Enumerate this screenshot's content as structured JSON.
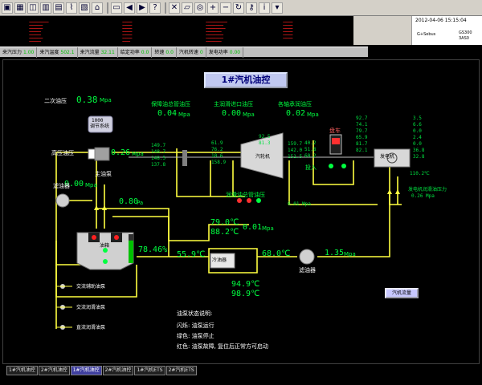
{
  "toolbar": {
    "icons": [
      "window-icon",
      "grid-icon",
      "chart-icon",
      "bar-icon",
      "table-icon",
      "trend-icon",
      "report-icon",
      "home-icon",
      "print-icon",
      "back-icon",
      "forward-icon",
      "help-icon",
      "close-icon",
      "folder-icon",
      "find-icon",
      "zoom-in-icon",
      "zoom-out-icon",
      "refresh-icon",
      "key-icon",
      "info-icon",
      "dropdown-icon"
    ]
  },
  "header": {
    "datetime": "2012-04-06  15:15:04",
    "station_left": "G+Sebus",
    "station_right_1": "GS300",
    "station_right_2": "3AS0"
  },
  "status_strip": [
    {
      "label": "来汽压力",
      "value": "1.00"
    },
    {
      "label": "来汽温度",
      "value": "502.1"
    },
    {
      "label": "来汽流量",
      "value": "32.11"
    },
    {
      "label": "给定功率",
      "value": "0.0"
    },
    {
      "label": "转速",
      "value": "0.0"
    },
    {
      "label": "汽机转速",
      "value": "0"
    },
    {
      "label": "发电功率",
      "value": "0.00"
    }
  ],
  "screen": {
    "title": "1#汽机油控",
    "secondary_oil_label": "二次油压",
    "secondary_oil_value": "0.38",
    "unit_mpa": "Mpa",
    "unit_pa": "Pa",
    "lube_header_label": "保障油总管油压",
    "lube_header_value": "0.04",
    "main_lube_label": "主润滑进口油压",
    "main_lube_value": "0.00",
    "bearing_oil_label": "各轴承润油压",
    "bearing_oil_value": "0.02",
    "hp_oil_label": "高压油压",
    "hp_oil_value": "0.26",
    "main_pump_label": "主油泵",
    "main_pump_value": "0.00",
    "filter_label": "滤油器",
    "filter_value": "0.80",
    "tank_label": "油箱",
    "tank_level_pct": 78.46,
    "tank_level_text": "78.46%",
    "cooler_label": "冷油器",
    "oil_temp_in_1": "79.0℃",
    "oil_temp_in_2": "88.2℃",
    "cooler_pressure": "0.01",
    "oil_temp_left": "55.9℃",
    "oil_temp_right": "68.0℃",
    "oil_temp_out_1": "94.9℃",
    "oil_temp_out_2": "98.9℃",
    "second_filter_label": "滤油器",
    "second_filter_pressure": "1.35",
    "turbine_label": "汽轮机",
    "generator_label": "发电机",
    "turning_gear_label": "盘车",
    "turning_gear_in": "投入",
    "speed_reg_label": "调节系统",
    "speed_reg_value": "1000",
    "bearing_temp_cols": [
      [
        "149.7",
        "148.7",
        "148.5",
        "137.8"
      ],
      [
        "61.9",
        "76.2",
        "10.6",
        "158.9"
      ],
      [
        "92.5",
        "81.3"
      ],
      [
        "40.2",
        "51.8",
        "60.2"
      ],
      [
        "159.7",
        "142.0",
        "151.5"
      ],
      [
        "92.7",
        "74.1",
        "79.7",
        "65.9",
        "81.7",
        "82.1"
      ],
      [
        "3.5",
        "6.6",
        "0.0",
        "2.4",
        "0.0",
        "36.8",
        "32.8"
      ]
    ],
    "bearing_temp_unit": "℃",
    "bearing_header_pressure_label": "润滑油总管油压",
    "lube_small_value": "0.01",
    "generator_oil_label": "发电机润滑油压力",
    "generator_oil_value": "0.26",
    "generator_temp": "110.2℃",
    "ac_pump_1": "交流辅助油泵",
    "ac_pump_2": "交流润滑油泵",
    "dc_pump": "直流润滑油泵",
    "legend_title": "油泵状态说明:",
    "legend_lines": [
      "闪烁: 油泵运行",
      "绿色: 油泵停止",
      "红色: 油泵故障, 复位后正常方可启动"
    ],
    "steam_flow_button": "汽机流量"
  },
  "tabs": [
    {
      "label": "1#汽机油控",
      "active": false
    },
    {
      "label": "2#汽机油控",
      "active": false
    },
    {
      "label": "1#汽机油控",
      "active": true
    },
    {
      "label": "2#汽机油控",
      "active": false
    },
    {
      "label": "1#汽机ETS",
      "active": false
    },
    {
      "label": "2#汽机ETS",
      "active": false
    }
  ],
  "colors": {
    "pipe": "#ffff40",
    "value": "#00ff40",
    "background": "#000000",
    "title_bg": "#c0c8f0",
    "alarm": "#ff2020"
  }
}
